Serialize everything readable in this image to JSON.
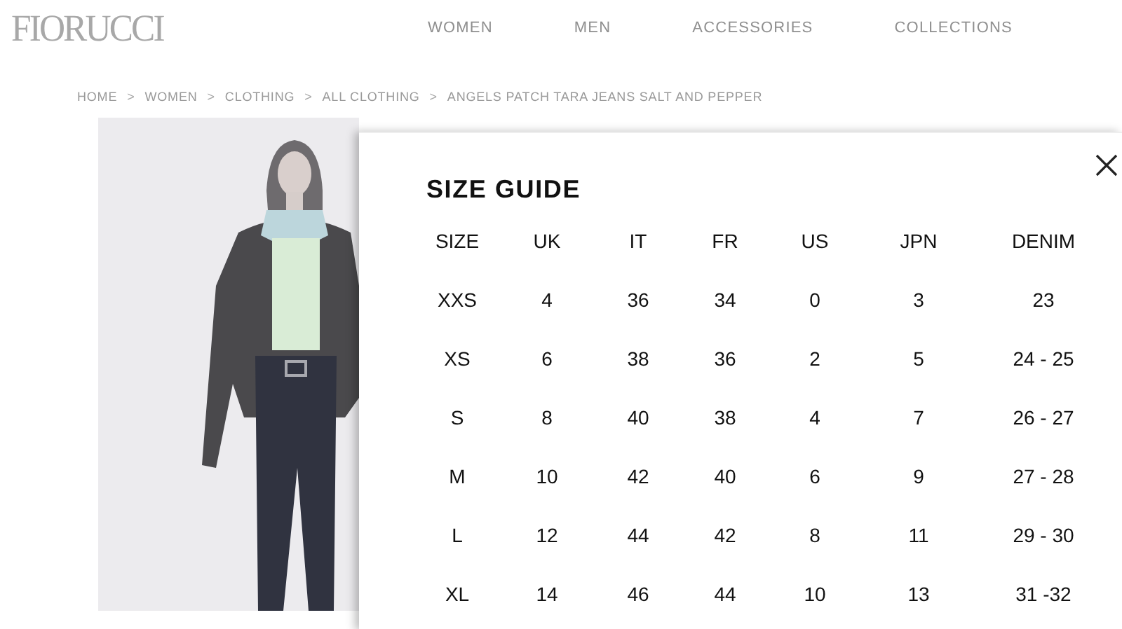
{
  "header": {
    "logo": "FIORUCCI",
    "nav": [
      "WOMEN",
      "MEN",
      "ACCESSORIES",
      "COLLECTIONS"
    ]
  },
  "breadcrumb": [
    {
      "kind": "link",
      "label": "HOME"
    },
    {
      "kind": "separator",
      "label": ">"
    },
    {
      "kind": "link",
      "label": "WOMEN"
    },
    {
      "kind": "separator",
      "label": ">"
    },
    {
      "kind": "link",
      "label": "CLOTHING"
    },
    {
      "kind": "separator",
      "label": ">"
    },
    {
      "kind": "link",
      "label": "ALL CLOTHING"
    },
    {
      "kind": "separator",
      "label": ">"
    },
    {
      "kind": "link",
      "label": "ANGELS PATCH TARA JEANS SALT AND PEPPER"
    }
  ],
  "size_guide": {
    "title": "SIZE GUIDE",
    "columns": [
      "SIZE",
      "UK",
      "IT",
      "FR",
      "US",
      "JPN",
      "DENIM"
    ],
    "rows": [
      [
        "XXS",
        "4",
        "36",
        "34",
        "0",
        "3",
        "23"
      ],
      [
        "XS",
        "6",
        "38",
        "36",
        "2",
        "5",
        "24 - 25"
      ],
      [
        "S",
        "8",
        "40",
        "38",
        "4",
        "7",
        "26 - 27"
      ],
      [
        "M",
        "10",
        "42",
        "40",
        "6",
        "9",
        "27 - 28"
      ],
      [
        "L",
        "12",
        "44",
        "42",
        "8",
        "11",
        "29 - 30"
      ],
      [
        "XL",
        "14",
        "46",
        "44",
        "10",
        "13",
        "31 -32"
      ]
    ]
  }
}
